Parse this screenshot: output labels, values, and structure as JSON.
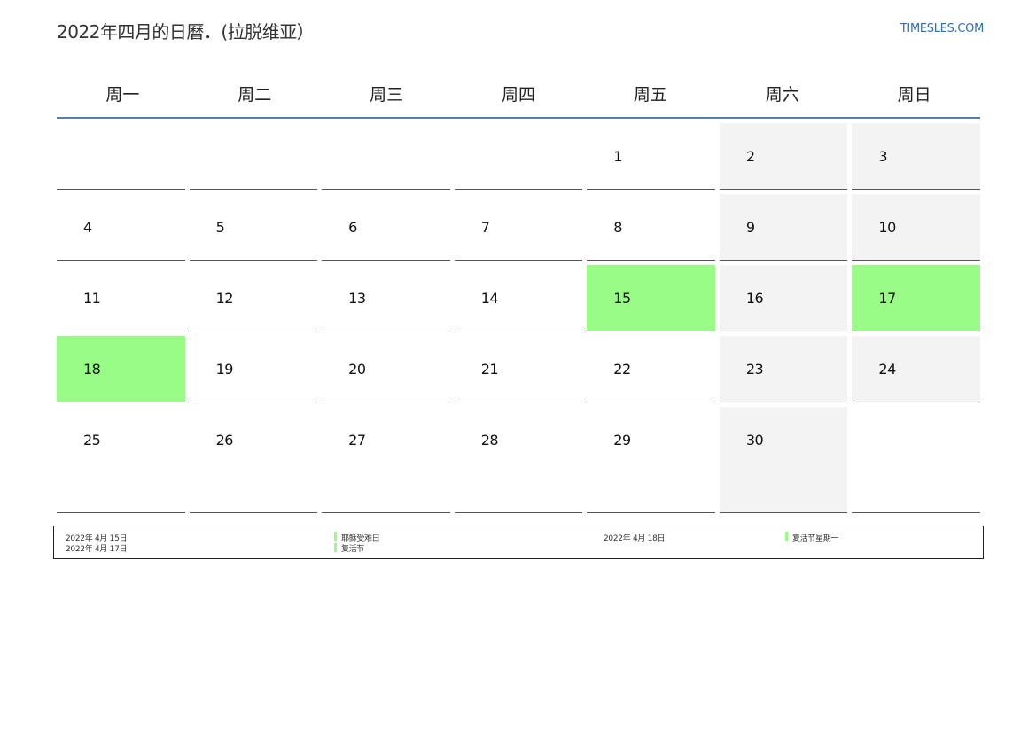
{
  "header": {
    "title": "2022年四月的日曆．(拉脱维亚）",
    "brand": "TIMESLES.COM"
  },
  "weekdays": [
    "周一",
    "周二",
    "周三",
    "周四",
    "周五",
    "周六",
    "周日"
  ],
  "weeks": [
    [
      "",
      "",
      "",
      "",
      "1",
      "2",
      "3"
    ],
    [
      "4",
      "5",
      "6",
      "7",
      "8",
      "9",
      "10"
    ],
    [
      "11",
      "12",
      "13",
      "14",
      "15",
      "16",
      "17"
    ],
    [
      "18",
      "19",
      "20",
      "21",
      "22",
      "23",
      "24"
    ],
    [
      "25",
      "26",
      "27",
      "28",
      "29",
      "30",
      ""
    ]
  ],
  "holidays": [
    "15",
    "17",
    "18"
  ],
  "colors": {
    "holiday": "#99fc87",
    "weekend": "#f3f3f3",
    "header_rule": "#5a7a9e",
    "brand": "#2f6fb3"
  },
  "legend": {
    "items": [
      {
        "date": "2022年 4月 15日",
        "name": "耶稣受难日"
      },
      {
        "date": "2022年 4月 17日",
        "name": "复活节"
      },
      {
        "date": "2022年 4月 18日",
        "name": "复活节星期一"
      }
    ]
  }
}
